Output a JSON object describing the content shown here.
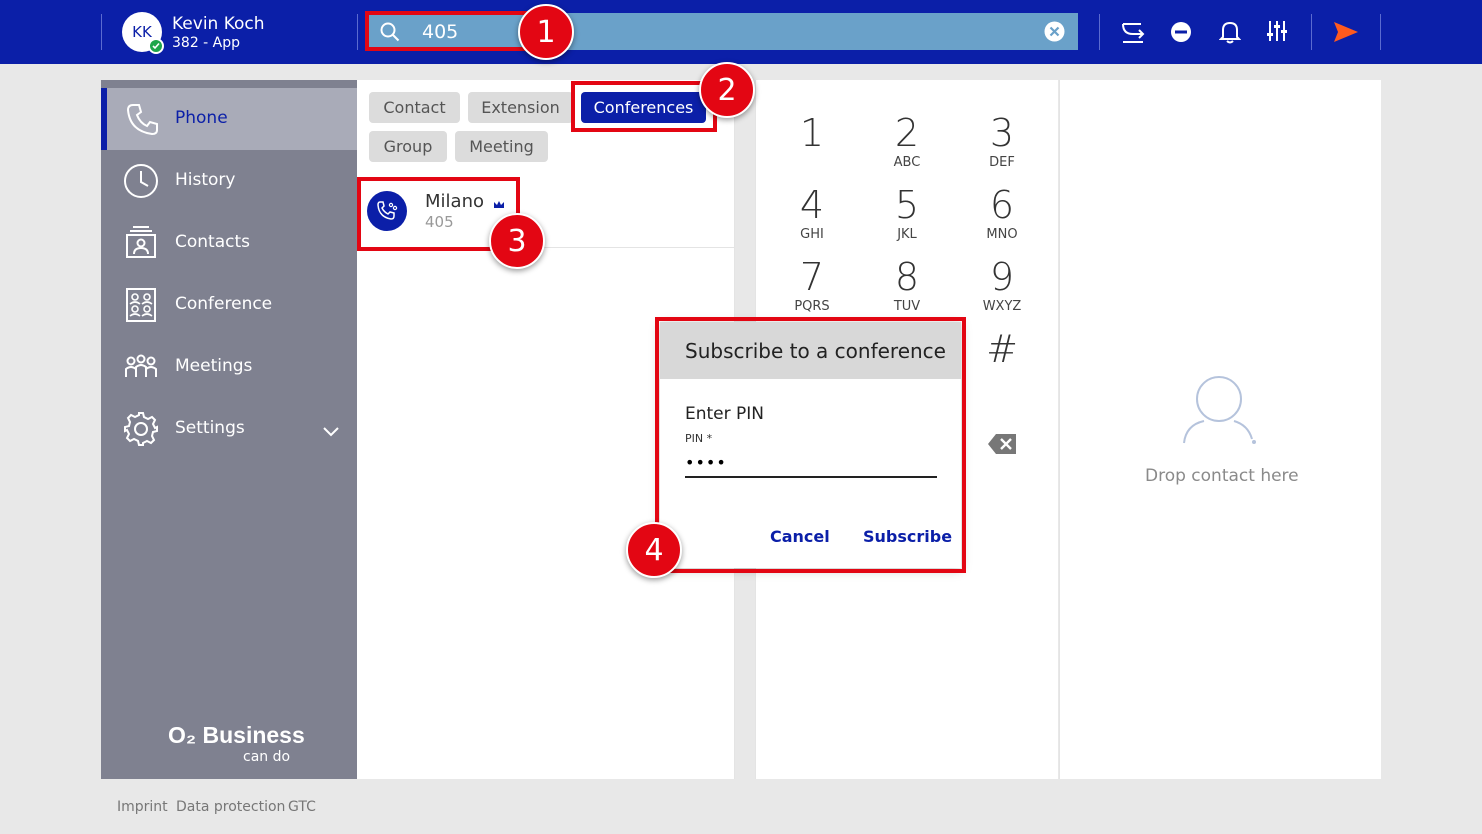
{
  "user": {
    "initials": "KK",
    "name": "Kevin Koch",
    "extension": "382 - App",
    "status_color": "#1ea64a"
  },
  "search": {
    "value": "405"
  },
  "colors": {
    "brand": "#0b1fa8",
    "annotation": "#e30613",
    "sidebar": "#7f8190"
  },
  "toolbar": {
    "icons": [
      "call-forward-icon",
      "dnd-icon",
      "bell-icon",
      "sliders-icon",
      "send-icon"
    ]
  },
  "annotations": [
    "1",
    "2",
    "3",
    "4"
  ],
  "sidebar": {
    "items": [
      {
        "label": "Phone",
        "icon": "phone-icon"
      },
      {
        "label": "History",
        "icon": "clock-icon"
      },
      {
        "label": "Contacts",
        "icon": "contacts-icon"
      },
      {
        "label": "Conference",
        "icon": "conference-icon"
      },
      {
        "label": "Meetings",
        "icon": "meetings-icon"
      },
      {
        "label": "Settings",
        "icon": "gear-icon"
      }
    ],
    "brand": "O₂ Business",
    "brand_sub": "can do"
  },
  "filters": [
    "Contact",
    "Extension",
    "Conferences",
    "Group",
    "Meeting"
  ],
  "active_filter": "Conferences",
  "result": {
    "name": "Milano",
    "number": "405"
  },
  "dialpad": [
    {
      "digit": "1",
      "letters": ""
    },
    {
      "digit": "2",
      "letters": "ABC"
    },
    {
      "digit": "3",
      "letters": "DEF"
    },
    {
      "digit": "4",
      "letters": "GHI"
    },
    {
      "digit": "5",
      "letters": "JKL"
    },
    {
      "digit": "6",
      "letters": "MNO"
    },
    {
      "digit": "7",
      "letters": "PQRS"
    },
    {
      "digit": "8",
      "letters": "TUV"
    },
    {
      "digit": "9",
      "letters": "WXYZ"
    },
    {
      "digit": "#",
      "letters": ""
    }
  ],
  "dropzone": {
    "text": "Drop contact here"
  },
  "dialog": {
    "title": "Subscribe to a conference",
    "subtitle": "Enter PIN",
    "pin_label": "PIN *",
    "pin_value": "••••",
    "cancel": "Cancel",
    "subscribe": "Subscribe"
  },
  "footer": [
    "Imprint",
    "Data protection",
    "GTC"
  ]
}
